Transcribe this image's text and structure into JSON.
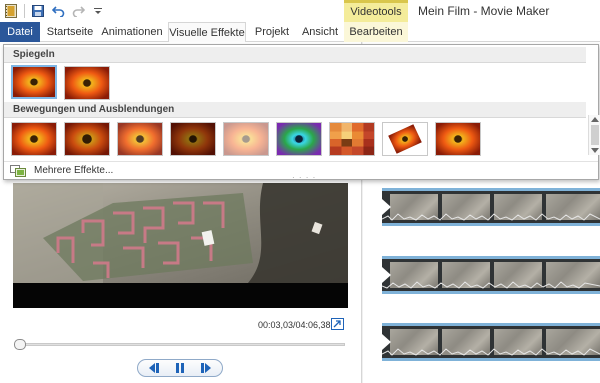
{
  "title_bar": {
    "title": "Mein Film - Movie Maker",
    "context_group": "Videotools"
  },
  "tabs": [
    "Datei",
    "Startseite",
    "Animationen",
    "Visuelle Effekte",
    "Projekt",
    "Ansicht",
    "Bearbeiten"
  ],
  "gallery": {
    "sections": [
      {
        "title": "Spiegeln"
      },
      {
        "title": "Bewegungen und Ausblendungen"
      }
    ],
    "more_effects": "Mehrere Effekte..."
  },
  "preview": {
    "timecode": "00:03,03/04:06,38"
  },
  "colors": {
    "file_tab": "#2b579a",
    "context_tab": "#f4ec9a",
    "accent_blue": "#1e63b8"
  },
  "icons": [
    "app-menu-icon",
    "save-icon",
    "undo-icon",
    "redo-icon",
    "customize-toolbar-icon",
    "expand-icon",
    "previous-frame-icon",
    "pause-icon",
    "next-frame-icon",
    "more-effects-icon"
  ]
}
